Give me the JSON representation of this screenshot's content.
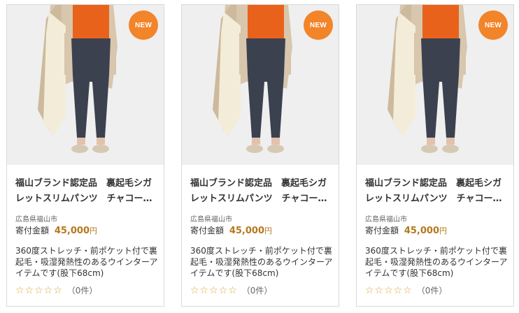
{
  "products": [
    {
      "badge": "NEW",
      "title": "福山ブランド認定品　裏起毛シガレットスリムパンツ　チャコー…",
      "region": "広島県福山市",
      "price_label": "寄付金額",
      "price": "45,000",
      "currency": "円",
      "description": "360度ストレッチ・前ポケット付で裏起毛・吸湿発熱性のあるウインターアイテムです(股下68cm)",
      "stars": "☆☆☆☆☆",
      "reviews": "（0件）"
    },
    {
      "badge": "NEW",
      "title": "福山ブランド認定品　裏起毛シガレットスリムパンツ　チャコー…",
      "region": "広島県福山市",
      "price_label": "寄付金額",
      "price": "45,000",
      "currency": "円",
      "description": "360度ストレッチ・前ポケット付で裏起毛・吸湿発熱性のあるウインターアイテムです(股下68cm)",
      "stars": "☆☆☆☆☆",
      "reviews": "（0件）"
    },
    {
      "badge": "NEW",
      "title": "福山ブランド認定品　裏起毛シガレットスリムパンツ　チャコー…",
      "region": "広島県福山市",
      "price_label": "寄付金額",
      "price": "45,000",
      "currency": "円",
      "description": "360度ストレッチ・前ポケット付で裏起毛・吸湿発熱性のあるウインターアイテムです(股下68cm)",
      "stars": "☆☆☆☆☆",
      "reviews": "（0件）"
    }
  ],
  "colors": {
    "badge": "#f2842a",
    "price": "#b5781c",
    "star": "#d7a83a"
  }
}
